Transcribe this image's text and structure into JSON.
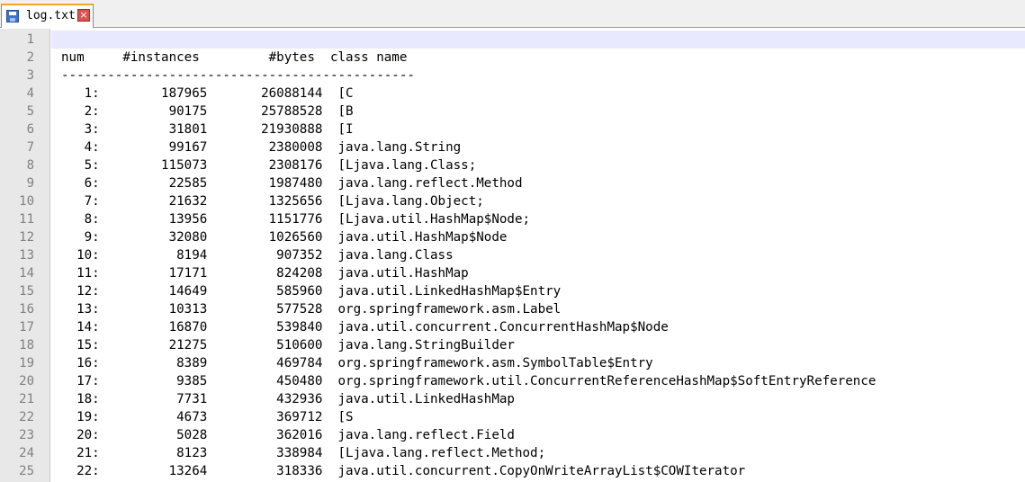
{
  "tab": {
    "title": "log.txt",
    "close_label": "×"
  },
  "editor": {
    "lines": [
      "",
      "num     #instances         #bytes  class name",
      "----------------------------------------------",
      "   1:        187965       26088144  [C",
      "   2:         90175       25788528  [B",
      "   3:         31801       21930888  [I",
      "   4:         99167        2380008  java.lang.String",
      "   5:        115073        2308176  [Ljava.lang.Class;",
      "   6:         22585        1987480  java.lang.reflect.Method",
      "   7:         21632        1325656  [Ljava.lang.Object;",
      "   8:         13956        1151776  [Ljava.util.HashMap$Node;",
      "   9:         32080        1026560  java.util.HashMap$Node",
      "  10:          8194         907352  java.lang.Class",
      "  11:         17171         824208  java.util.HashMap",
      "  12:         14649         585960  java.util.LinkedHashMap$Entry",
      "  13:         10313         577528  org.springframework.asm.Label",
      "  14:         16870         539840  java.util.concurrent.ConcurrentHashMap$Node",
      "  15:         21275         510600  java.lang.StringBuilder",
      "  16:          8389         469784  org.springframework.asm.SymbolTable$Entry",
      "  17:          9385         450480  org.springframework.util.ConcurrentReferenceHashMap$SoftEntryReference",
      "  18:          7731         432936  java.util.LinkedHashMap",
      "  19:          4673         369712  [S",
      "  20:          5028         362016  java.lang.reflect.Field",
      "  21:          8123         338984  [Ljava.lang.reflect.Method;",
      "  22:         13264         318336  java.util.concurrent.CopyOnWriteArrayList$COWIterator"
    ],
    "line_numbers": [
      "1",
      "2",
      "3",
      "4",
      "5",
      "6",
      "7",
      "8",
      "9",
      "10",
      "11",
      "12",
      "13",
      "14",
      "15",
      "16",
      "17",
      "18",
      "19",
      "20",
      "21",
      "22",
      "23",
      "24",
      "25"
    ]
  },
  "colors": {
    "active_line": "#e8e8ff",
    "gutter": "#e8e8e8",
    "line_number": "#808080"
  }
}
